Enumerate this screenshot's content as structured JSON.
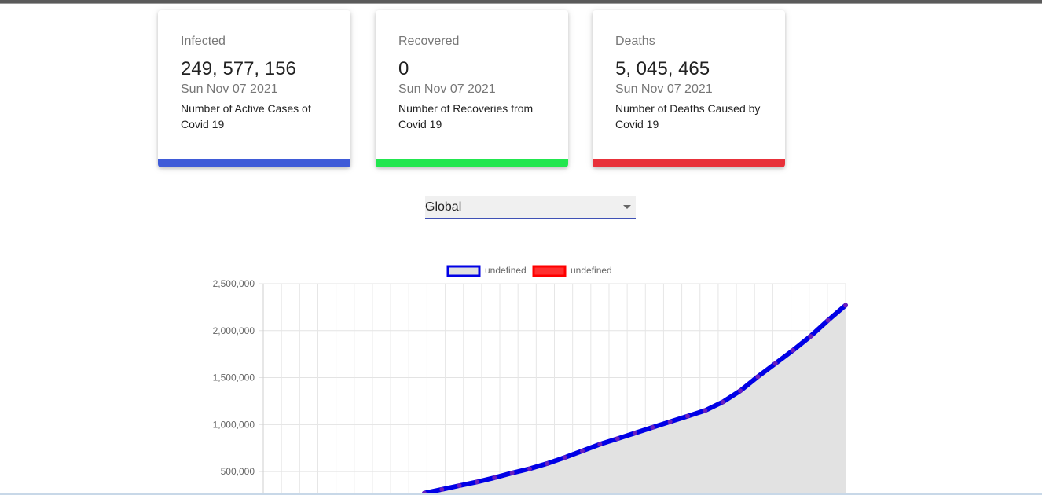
{
  "cards": [
    {
      "title": "Infected",
      "value": "249, 577, 156",
      "date": "Sun Nov 07 2021",
      "description": "Number of Active Cases of Covid 19",
      "color": "#3f5bd8"
    },
    {
      "title": "Recovered",
      "value": "0",
      "date": "Sun Nov 07 2021",
      "description": "Number of Recoveries from Covid 19",
      "color": "#22e64f"
    },
    {
      "title": "Deaths",
      "value": "5, 045, 465",
      "date": "Sun Nov 07 2021",
      "description": "Number of Deaths Caused by Covid 19",
      "color": "#e8313a"
    }
  ],
  "country_select": {
    "value": "Global"
  },
  "chart_data": {
    "type": "line",
    "title": "",
    "xlabel": "",
    "ylabel": "",
    "ylim": [
      250000,
      2500000
    ],
    "y_ticks": [
      "2,500,000",
      "2,000,000",
      "1,500,000",
      "1,000,000",
      "500,000"
    ],
    "grid": true,
    "legend_position": "top",
    "series": [
      {
        "name": "undefined",
        "color": "#0000e6",
        "fill": "#e0e0e0",
        "values": [
          270000,
          310000,
          350000,
          390000,
          435000,
          485000,
          530000,
          585000,
          650000,
          720000,
          790000,
          850000,
          910000,
          970000,
          1030000,
          1090000,
          1150000,
          1240000,
          1360000,
          1510000,
          1650000,
          1790000,
          1940000,
          2110000,
          2270000
        ]
      },
      {
        "name": "undefined",
        "color": "#ff0000",
        "fill": "#ff3030",
        "values": []
      }
    ]
  }
}
